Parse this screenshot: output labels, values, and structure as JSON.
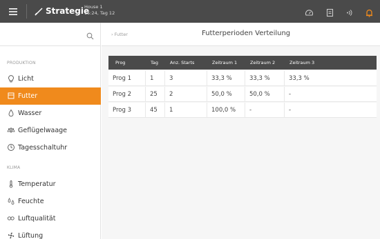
{
  "topbar": {
    "brand": "Strategie",
    "house_name": "House 1",
    "house_time": "15:24, Tag 12",
    "icons": [
      "menu-icon",
      "logo-icon",
      "gauge-icon",
      "notepad-icon",
      "wireless-icon",
      "alarm-icon"
    ],
    "alarm_color": "#f08a1c"
  },
  "sidebar": {
    "section_production": "PRODUKTION",
    "section_climate": "KLIMA",
    "items": [
      {
        "label": "Licht",
        "icon": "bulb-icon"
      },
      {
        "label": "Futter",
        "icon": "feed-icon",
        "active": true
      },
      {
        "label": "Wasser",
        "icon": "drop-icon"
      },
      {
        "label": "Geflügelwaage",
        "icon": "scale-icon"
      },
      {
        "label": "Tagesschaltuhr",
        "icon": "clock-icon"
      },
      {
        "label": "Temperatur",
        "icon": "thermometer-icon"
      },
      {
        "label": "Feuchte",
        "icon": "humidity-icon"
      },
      {
        "label": "Luftqualität",
        "icon": "co2-icon"
      },
      {
        "label": "Lüftung",
        "icon": "fan-icon"
      }
    ]
  },
  "main": {
    "breadcrumb": "› Futter",
    "title": "Futterperioden Verteilung",
    "columns": [
      "Prog",
      "Tag",
      "Anz. Starts",
      "Zeitraum 1",
      "Zeitraum 2",
      "Zeitraum 3"
    ],
    "rows": [
      [
        "Prog 1",
        "1",
        "3",
        "33,3 %",
        "33,3 %",
        "33,3 %"
      ],
      [
        "Prog 2",
        "25",
        "2",
        "50,0 %",
        "50,0 %",
        "-"
      ],
      [
        "Prog 3",
        "45",
        "1",
        "100,0 %",
        "-",
        "-"
      ]
    ]
  },
  "colors": {
    "accent": "#f08a1c",
    "topbar": "#4a4a4a",
    "table_header": "#4a4a4a"
  }
}
